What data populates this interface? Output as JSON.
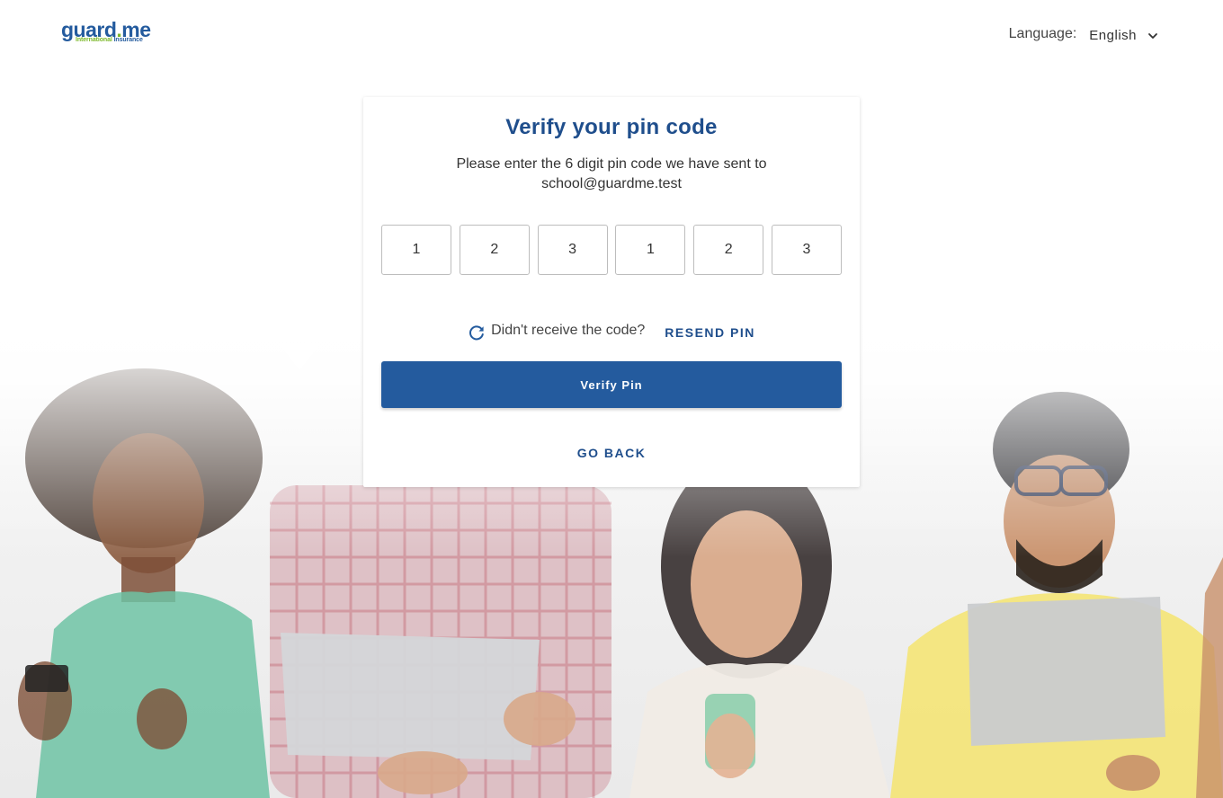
{
  "header": {
    "logo_text": "guard",
    "logo_dot": ".",
    "logo_suffix": "me",
    "logo_tag_green": "International",
    "logo_tag_blue": "Insurance",
    "language_label": "Language:",
    "language_value": "English"
  },
  "card": {
    "title": "Verify your pin code",
    "subtitle_line1": "Please enter the 6 digit pin code we have sent to",
    "subtitle_line2": "school@guardme.test",
    "pin_digits": [
      "1",
      "2",
      "3",
      "1",
      "2",
      "3"
    ],
    "resend_prompt": "Didn't receive the code?",
    "resend_link": "RESEND PIN",
    "verify_button": "Verify Pin",
    "go_back": "GO BACK"
  },
  "colors": {
    "brand_blue": "#245b9e",
    "title_blue": "#1f4e8c",
    "brand_green": "#7cb829"
  },
  "icons": {
    "language": "chevron-down-icon",
    "resend": "refresh-icon"
  },
  "background": {
    "description_icon": "people-with-devices-photo"
  }
}
